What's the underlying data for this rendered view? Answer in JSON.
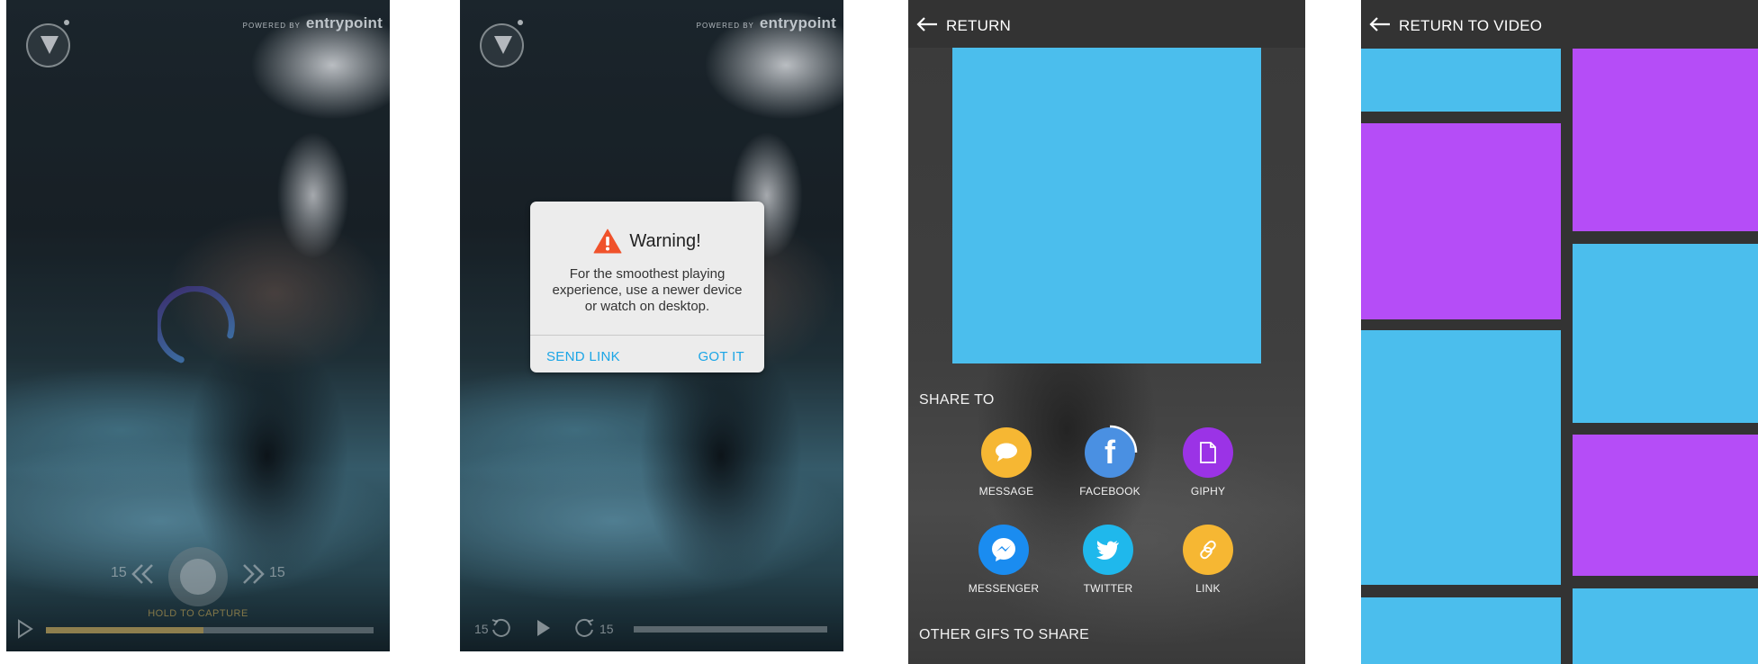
{
  "brand": {
    "powered_by": "POWERED BY",
    "name": "entrypoint"
  },
  "screen1": {
    "skip_back": "15",
    "skip_forward": "15",
    "hold_to_capture": "HOLD TO CAPTURE",
    "progress_fraction": 0.48
  },
  "screen2": {
    "rewind_seconds": "15",
    "forward_seconds": "15",
    "progress_fraction": 0.0,
    "dialog": {
      "title": "Warning!",
      "body": "For the smoothest playing experience, use a newer device or watch on desktop.",
      "send_link": "SEND LINK",
      "got_it": "GOT IT"
    }
  },
  "screen3": {
    "header_title": "RETURN",
    "share_to": "SHARE TO",
    "share_items": [
      {
        "label": "MESSAGE",
        "icon": "chat-bubble-icon",
        "color": "#f6b733"
      },
      {
        "label": "FACEBOOK",
        "icon": "facebook-icon",
        "color": "#4a90e2"
      },
      {
        "label": "GIPHY",
        "icon": "document-icon",
        "color": "#9b33e6"
      },
      {
        "label": "MESSENGER",
        "icon": "messenger-icon",
        "color": "#1a8cf0"
      },
      {
        "label": "TWITTER",
        "icon": "twitter-icon",
        "color": "#1fb8ec"
      },
      {
        "label": "LINK",
        "icon": "link-icon",
        "color": "#f6b733"
      }
    ],
    "other_gifs": "OTHER GIFS TO SHARE",
    "gif_color": "#4bbeed"
  },
  "screen4": {
    "header_title": "RETURN TO VIDEO",
    "tile_colors": {
      "blue": "#4bbeed",
      "purple": "#b54df7"
    }
  }
}
